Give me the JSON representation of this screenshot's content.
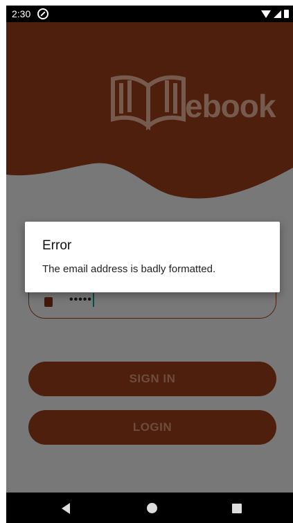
{
  "status_bar": {
    "time": "2:30",
    "icons": [
      "do-not-disturb-icon",
      "wifi-icon",
      "signal-icon",
      "battery-icon"
    ]
  },
  "header": {
    "logo_text": "ebook",
    "brand_color": "#8c3a17"
  },
  "form": {
    "password_mask": "•••••",
    "icons": [
      "lock-icon"
    ]
  },
  "buttons": {
    "sign_in": "SIGN IN",
    "login": "LOGIN"
  },
  "dialog": {
    "title": "Error",
    "message": "The email address is badly formatted."
  },
  "nav_bar": {
    "icons": [
      "back-icon",
      "home-icon",
      "recents-icon"
    ]
  }
}
